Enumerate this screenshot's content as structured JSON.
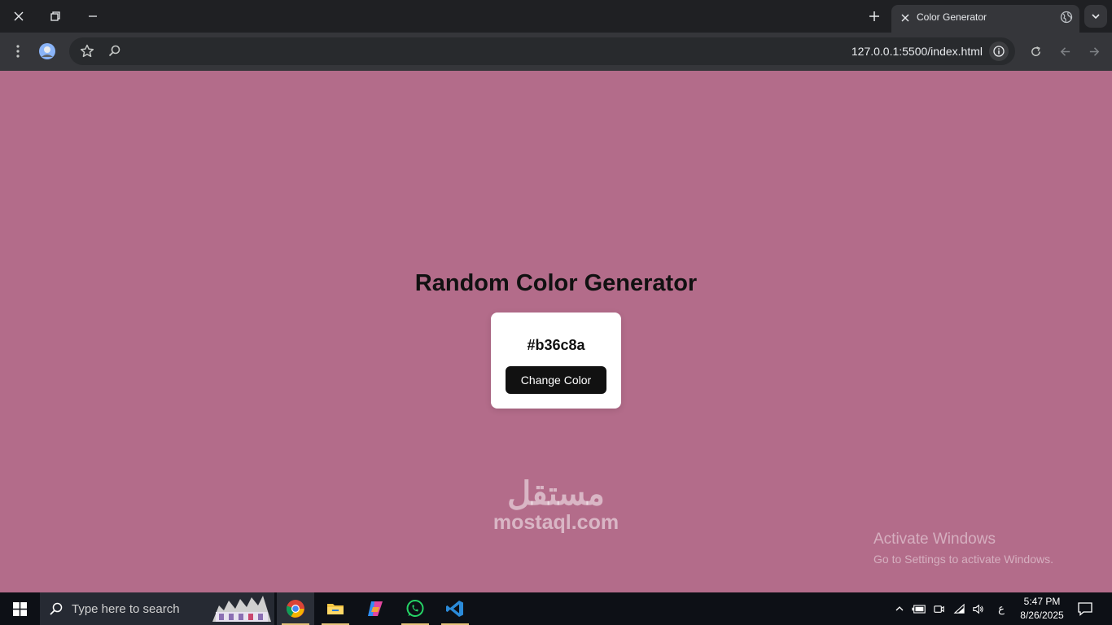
{
  "browser": {
    "tab_title": "Color Generator",
    "url": "127.0.0.1:5500/index.html"
  },
  "page": {
    "heading": "Random Color Generator",
    "hex_value": "#b36c8a",
    "button_label": "Change Color",
    "background_color": "#b36c8a"
  },
  "overlay": {
    "activate_title": "Activate Windows",
    "activate_subtitle": "Go to Settings to activate Windows.",
    "watermark_arabic": "مستقل",
    "watermark_latin": "mostaql.com"
  },
  "taskbar": {
    "search_placeholder": "Type here to search",
    "input_indicator": "ع",
    "time": "5:47 PM",
    "date": "8/26/2025",
    "apps": [
      "chrome-icon",
      "file-explorer-icon",
      "copilot-icon",
      "whatsapp-icon",
      "vscode-icon"
    ]
  },
  "colors": {
    "accent_dark": "#111111",
    "card": "#ffffff",
    "taskbar": "#0d1016"
  }
}
